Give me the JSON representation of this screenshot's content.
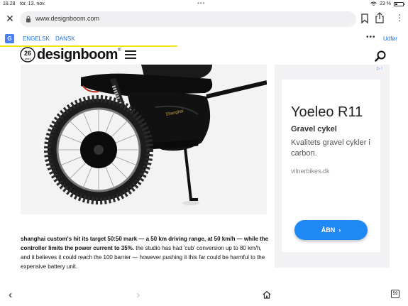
{
  "status_bar": {
    "time": "18.28",
    "date": "tor. 13. nov.",
    "battery_text": "23 %",
    "battery_level": 0.23
  },
  "browser": {
    "url": "www.designboom.com"
  },
  "translate_bar": {
    "tabs": [
      "ENGELSK",
      "DANSK"
    ],
    "more": "•••",
    "done_label": "Udfør"
  },
  "site": {
    "logo_badge_number": "26",
    "logo_badge_text": "years",
    "logo_text": "designboom",
    "logo_registered": "®"
  },
  "article": {
    "caption_bold": "shanghai custom's hit its target 50:50 mark — a 50 km driving range, at 50 km/h — while the controller limits the power current to 35%.",
    "caption_rest": " the studio has had 'cub' conversion up to 80 km/h, and it believes it could reach the 100 barrier — however pushing it this far could be harmful to the expensive battery unit."
  },
  "ad": {
    "choices_label": "▷ ⁝",
    "title": "Yoeleo R11",
    "subtitle": "Gravel cykel",
    "body": "Kvalitets gravel cykler i carbon.",
    "domain": "vilnerbikes.dk",
    "cta_label": "ÅBN",
    "accent_color": "#1e88f5"
  },
  "toolbar": {
    "tabs_count": "59"
  }
}
